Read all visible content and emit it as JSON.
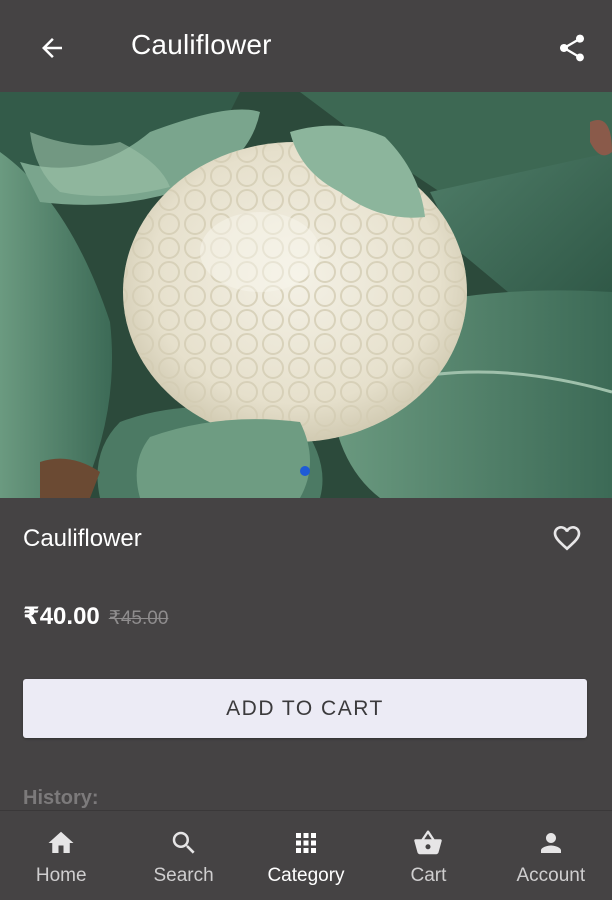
{
  "app_bar": {
    "title": "Cauliflower",
    "back_icon": "arrow-back-icon",
    "share_icon": "share-icon"
  },
  "gallery": {
    "image_subject": "cauliflower",
    "page_indicator_color": "#1e5bd6"
  },
  "product": {
    "name": "Cauliflower",
    "price": "₹40.00",
    "mrp": "₹45.00",
    "favorite_icon": "heart-outline-icon"
  },
  "actions": {
    "add_to_cart_label": "ADD TO CART"
  },
  "sections": {
    "history_label": "History:"
  },
  "bottom_nav": {
    "items": [
      {
        "label": "Home",
        "icon": "home-icon"
      },
      {
        "label": "Search",
        "icon": "search-icon"
      },
      {
        "label": "Category",
        "icon": "grid-icon",
        "active": true
      },
      {
        "label": "Cart",
        "icon": "basket-icon"
      },
      {
        "label": "Account",
        "icon": "account-icon"
      }
    ]
  },
  "colors": {
    "background": "#454344",
    "button_bg": "#ecebf5",
    "button_text": "#3b3a3c",
    "strikethrough_price": "#8e8c8d"
  }
}
